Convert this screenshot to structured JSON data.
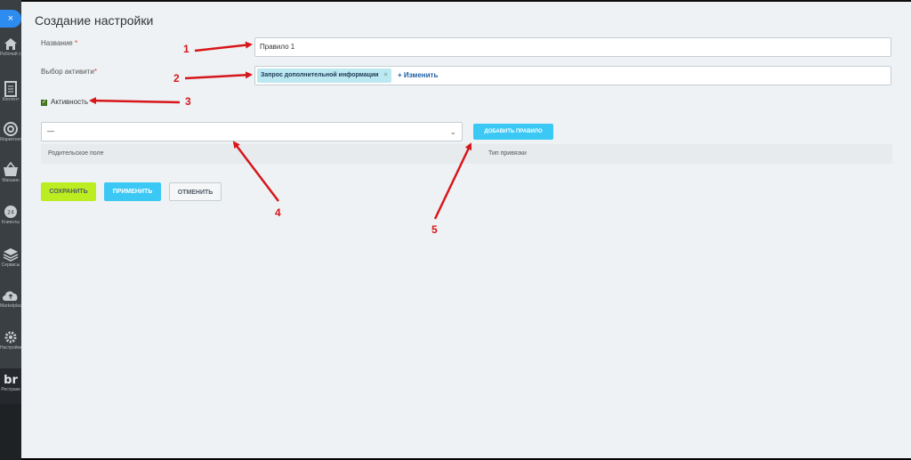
{
  "sidebar": {
    "close_label": "×",
    "items": [
      {
        "label": "Рабочий стол",
        "icon": "home-icon"
      },
      {
        "label": "Контент",
        "icon": "document-icon"
      },
      {
        "label": "Маркетинг",
        "icon": "target-icon"
      },
      {
        "label": "Магазин",
        "icon": "basket-icon"
      },
      {
        "label": "Клиенты",
        "icon": "clock-24-icon"
      },
      {
        "label": "Сервисы",
        "icon": "layers-icon"
      },
      {
        "label": "Marketplace",
        "icon": "cloud-upload-icon"
      },
      {
        "label": "Настройки",
        "icon": "gear-icon"
      },
      {
        "label": "Рестранк",
        "icon": "brand-logo-icon"
      }
    ]
  },
  "page": {
    "title": "Создание настройки"
  },
  "form": {
    "name_label": "Название",
    "name_required_mark": "*",
    "name_value": "Правило 1",
    "activity_label": "Выбор активити",
    "activity_required_mark": "*",
    "activity_tag": "Запрос дополнительной информации",
    "activity_tag_remove": "×",
    "activity_change_link": "+ Изменить",
    "active_checkbox_label": "Активность",
    "rule_select_value": "—",
    "add_rule_button": "ДОБАВИТЬ ПРАВИЛО"
  },
  "table": {
    "columns": [
      "Родительское поле",
      "Тип привязки"
    ]
  },
  "buttons": {
    "save": "СОХРАНИТЬ",
    "apply": "ПРИМЕНИТЬ",
    "cancel": "ОТМЕНИТЬ"
  },
  "annotations": {
    "color": "#d8161a",
    "labels": [
      "1",
      "2",
      "3",
      "4",
      "5"
    ]
  }
}
